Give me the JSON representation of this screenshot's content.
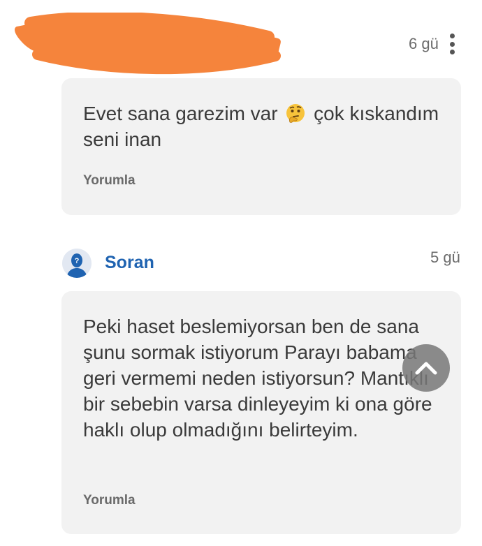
{
  "comments": [
    {
      "author": "",
      "time": "6 gü",
      "text_before_emoji": "Evet sana garezim var",
      "emoji": "thinking-face-emoji",
      "text_after_emoji": "çok kıskandım seni inan",
      "reply_label": "Yorumla"
    },
    {
      "author": "Soran",
      "time": "5 gü",
      "text": "Peki haset beslemiyorsan ben de sana şunu sormak istiyorum Parayı babama geri vermemi neden istiyorsun? Mantıklı bir sebebin varsa dinleyeyim ki ona göre haklı olup olmadığını belirteyim.",
      "reply_label": "Yorumla"
    }
  ],
  "icons": {
    "more": "kebab-menu-icon",
    "scroll_top": "chevron-up-icon",
    "avatar": "anonymous-user-icon"
  },
  "colors": {
    "redaction": "#f5843c",
    "username": "#1f63b1",
    "bubble": "#f2f2f2"
  }
}
